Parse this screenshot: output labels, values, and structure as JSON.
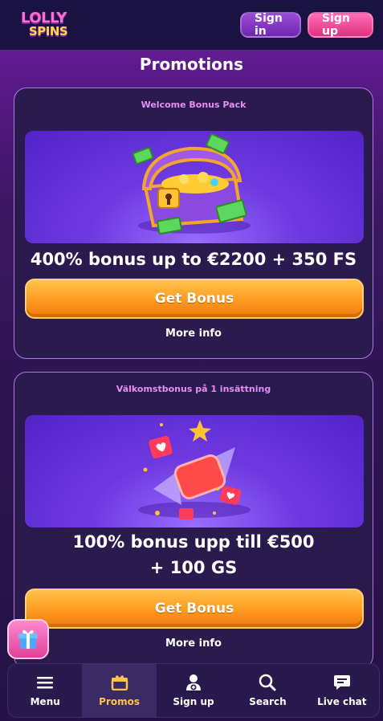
{
  "header": {
    "logo_top": "LOLLY",
    "logo_bottom": "SPINS",
    "signin_label": "Sign in",
    "signup_label": "Sign up"
  },
  "page_title": "Promotions",
  "promos": [
    {
      "subtitle": "Welcome Bonus Pack",
      "headline": "400% bonus up to €2200 + 350 FS",
      "button_label": "Get Bonus",
      "more_label": "More info"
    },
    {
      "subtitle": "Välkomstbonus på 1 insättning",
      "headline_line1": "100% bonus upp till €500",
      "headline_line2": "+ 100 GS",
      "button_label": "Get Bonus",
      "more_label": "More info"
    }
  ],
  "bottom_nav": {
    "items": [
      {
        "label": "Menu",
        "icon": "menu-icon"
      },
      {
        "label": "Promos",
        "icon": "promos-icon",
        "active": true
      },
      {
        "label": "Sign up",
        "icon": "user-add-icon"
      },
      {
        "label": "Search",
        "icon": "search-icon"
      },
      {
        "label": "Live chat",
        "icon": "chat-icon"
      }
    ]
  },
  "colors": {
    "accent": "#ffc24a",
    "card_border": "#b07adf",
    "button_orange": "#ff9a20",
    "signup_pink": "#e0307f"
  }
}
